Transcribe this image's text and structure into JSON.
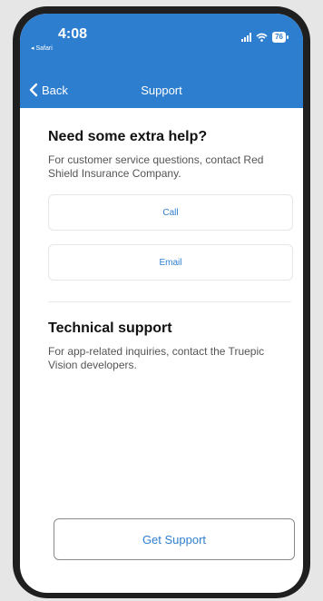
{
  "status_bar": {
    "time": "4:08",
    "back_app": "◂ Safari",
    "battery": "76"
  },
  "nav": {
    "back_label": "Back",
    "title": "Support"
  },
  "section1": {
    "heading": "Need some extra help?",
    "text": "For customer service questions, contact Red Shield Insurance Company.",
    "call_label": "Call",
    "email_label": "Email"
  },
  "section2": {
    "heading": "Technical support",
    "text": "For app-related inquiries, contact the Truepic Vision developers."
  },
  "footer": {
    "button_label": "Get Support"
  },
  "colors": {
    "accent": "#2e7ecf",
    "frame": "#1f1f1f",
    "background": "#e6e6e6"
  }
}
